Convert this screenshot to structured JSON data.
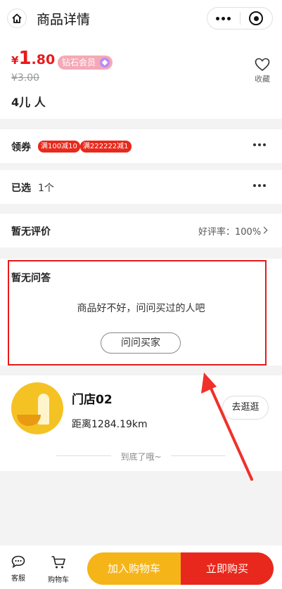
{
  "header": {
    "title": "商品详情",
    "home_icon": "home-icon",
    "more_icon": "more-dots-icon",
    "close_icon": "mini-program-close-icon"
  },
  "product": {
    "currency": "¥",
    "price_int": "1",
    "price_dec": ".80",
    "member_badge": "钻石会员",
    "original_price": "¥3.00",
    "name": "4儿 人",
    "favorite_label": "收藏"
  },
  "coupon": {
    "label": "领券",
    "tags": [
      "满100减10",
      "满222222减1"
    ]
  },
  "spec": {
    "label": "已选",
    "value": "1个"
  },
  "review": {
    "label": "暂无评价",
    "rate_label": "好评率：",
    "rate_value": "100%"
  },
  "qa": {
    "title": "暂无问答",
    "empty_text": "商品好不好，问问买过的人吧",
    "ask_button": "问问买家"
  },
  "store": {
    "name": "门店02",
    "distance": "距离1284.19km",
    "visit_button": "去逛逛"
  },
  "footer_text": "到底了哦~",
  "bottom_bar": {
    "service_label": "客服",
    "cart_label": "购物车",
    "add_cart_button": "加入购物车",
    "buy_now_button": "立即购买"
  },
  "colors": {
    "price_red": "#e8191c",
    "cart_yellow": "#f5b519",
    "buy_red": "#e8281c",
    "member_pink": "#f5a9b6"
  }
}
